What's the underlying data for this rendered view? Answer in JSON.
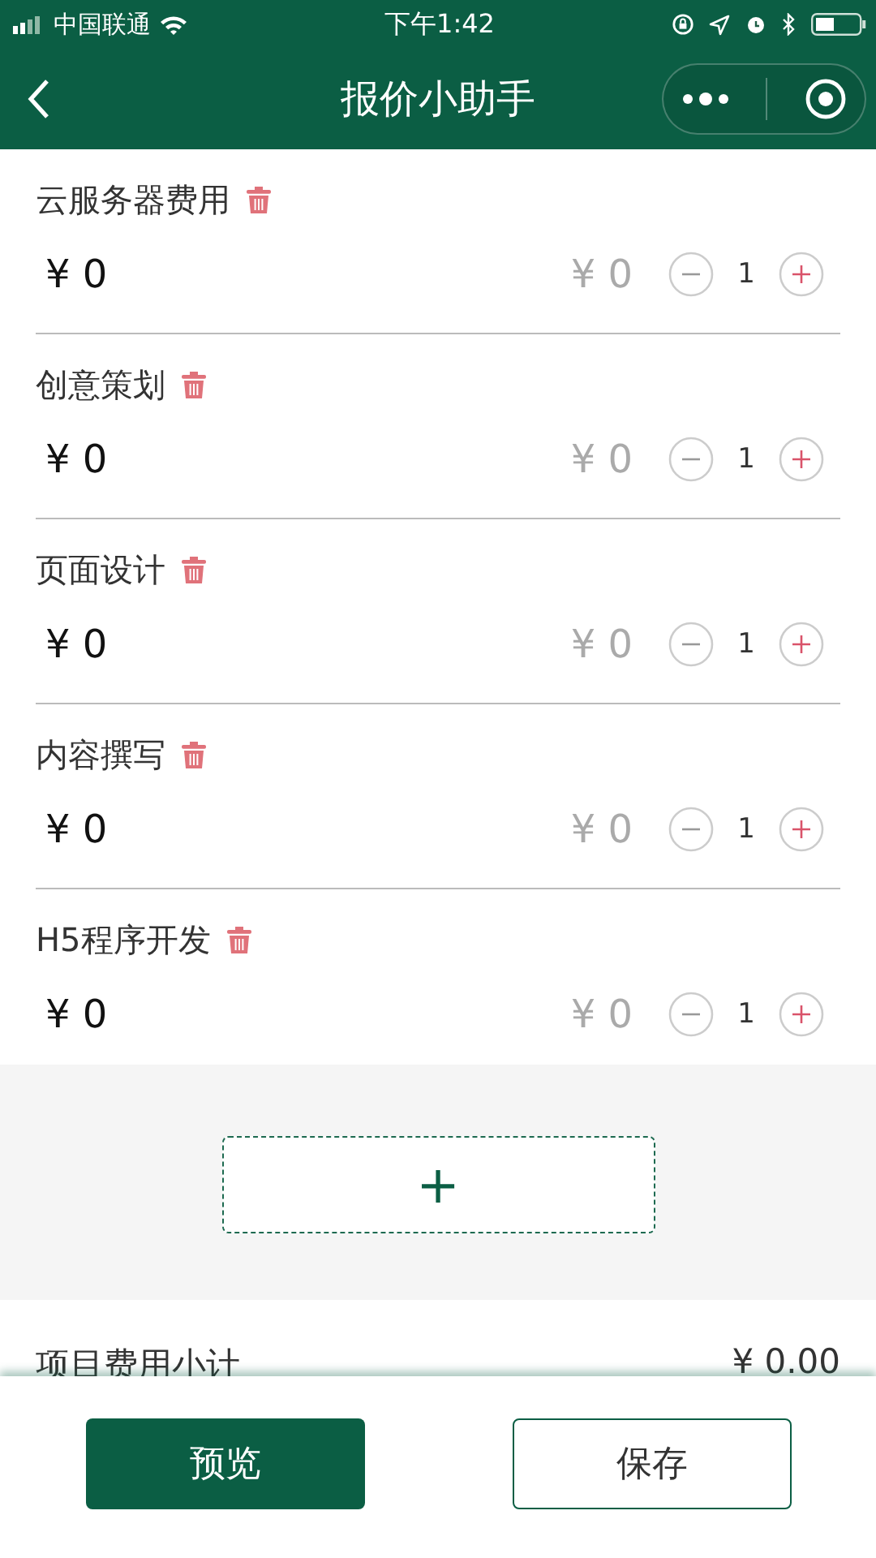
{
  "status_bar": {
    "carrier": "中国联通",
    "time": "下午1:42"
  },
  "nav": {
    "title": "报价小助手"
  },
  "items": [
    {
      "name": "云服务器费用",
      "amount": "¥ 0",
      "unit_price": "¥ 0",
      "quantity": "1"
    },
    {
      "name": "创意策划",
      "amount": "¥ 0",
      "unit_price": "¥ 0",
      "quantity": "1"
    },
    {
      "name": "页面设计",
      "amount": "¥ 0",
      "unit_price": "¥ 0",
      "quantity": "1"
    },
    {
      "name": "内容撰写",
      "amount": "¥ 0",
      "unit_price": "¥ 0",
      "quantity": "1"
    },
    {
      "name": "H5程序开发",
      "amount": "¥ 0",
      "unit_price": "¥ 0",
      "quantity": "1"
    }
  ],
  "add_button": {
    "label": "+"
  },
  "subtotal": {
    "label": "项目费用小计",
    "value": "¥ 0.00"
  },
  "buttons": [
    {
      "label": "预览",
      "kind": "primary"
    },
    {
      "label": "保存",
      "kind": "outline"
    }
  ]
}
